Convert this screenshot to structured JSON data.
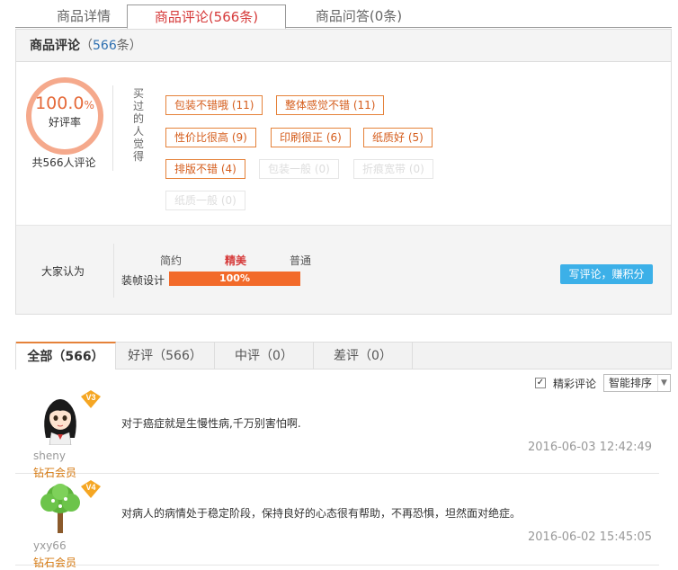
{
  "top_tabs": [
    {
      "label": "商品详情"
    },
    {
      "label": "商品评论(566条)"
    },
    {
      "label": "商品问答(0条)"
    }
  ],
  "summary": {
    "title": "商品评论",
    "count_open": "（",
    "count": "566",
    "count_close": "条）",
    "rate_value": "100.0",
    "rate_pct": "%",
    "rate_label": "好评率",
    "total_label": "共566人评论",
    "bought_label": "买过的人觉得",
    "tags": [
      {
        "label": "包装不错哦 (11)",
        "active": true
      },
      {
        "label": "整体感觉不错 (11)",
        "active": true
      },
      {
        "label": "性价比很高 (9)",
        "active": true
      },
      {
        "label": "印刷很正 (6)",
        "active": true
      },
      {
        "label": "纸质好 (5)",
        "active": true
      },
      {
        "label": "排版不错 (4)",
        "active": true
      },
      {
        "label": "包装一般 (0)",
        "active": false
      },
      {
        "label": "折痕宽带 (0)",
        "active": false
      },
      {
        "label": "纸质一般 (0)",
        "active": false
      }
    ],
    "opinion": {
      "label": "大家认为",
      "bar_name": "装帧设计",
      "options": [
        "简约",
        "精美",
        "普通"
      ],
      "value_text": "100%",
      "value": 100,
      "write_button": "写评论，赚积分"
    }
  },
  "filters": [
    {
      "label": "全部（566）"
    },
    {
      "label": "好评（566）"
    },
    {
      "label": "中评（0）"
    },
    {
      "label": "差评（0）"
    }
  ],
  "sort": {
    "checkbox_label": "精彩评论",
    "checked": true,
    "check_mark": "✓",
    "select_value": "智能排序",
    "select_arrow": "▼"
  },
  "reviews": [
    {
      "user": "sheny",
      "level": "钻石会员",
      "vip": "V3",
      "text": "对于癌症就是生慢性病,千万别害怕啊.",
      "date": "2016-06-03 12:42:49"
    },
    {
      "user": "yxy66",
      "level": "钻石会员",
      "vip": "V4",
      "text": "对病人的病情处于稳定阶段，保持良好的心态很有帮助，不再恐惧，坦然面对绝症。",
      "date": "2016-06-02 15:45:05"
    }
  ]
}
